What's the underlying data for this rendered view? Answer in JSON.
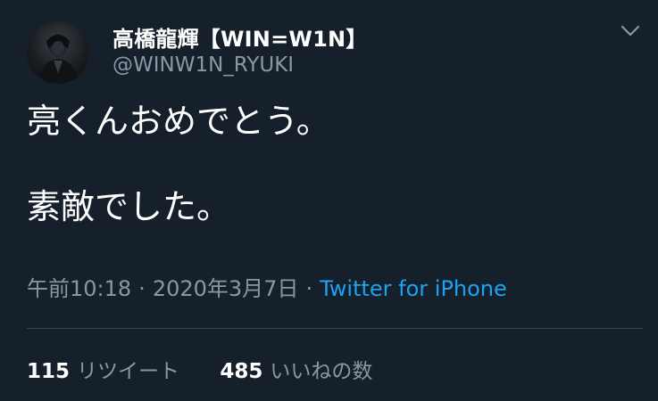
{
  "tweet": {
    "author": {
      "display_name": "高橋龍輝【WIN=W1N】",
      "handle": "@WINW1N_RYUKI"
    },
    "text_lines": [
      "亮くんおめでとう。",
      "",
      "素敵でした。"
    ],
    "timestamp": "午前10:18",
    "separator": "·",
    "date": "2020年3月7日",
    "source": "Twitter for iPhone",
    "retweets": {
      "count": "115",
      "label": "リツイート"
    },
    "likes": {
      "count": "485",
      "label": "いいねの数"
    }
  },
  "colors": {
    "background": "#15202b",
    "text": "#ffffff",
    "secondary": "#8899a6",
    "link": "#1da1f2",
    "divider": "#38444d"
  },
  "icons": {
    "more": "chevron-down-icon"
  }
}
